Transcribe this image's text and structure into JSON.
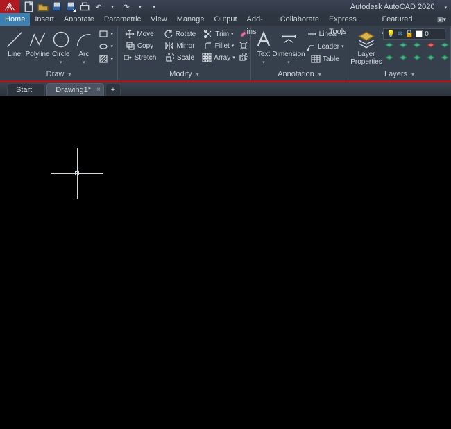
{
  "app": {
    "title": "Autodesk AutoCAD 2020"
  },
  "qat_hint": {
    "undo": "◄",
    "redo": "►"
  },
  "menutabs": [
    "Home",
    "Insert",
    "Annotate",
    "Parametric",
    "View",
    "Manage",
    "Output",
    "Add-ins",
    "Collaborate",
    "Express Tools",
    "Featured Apps"
  ],
  "menutabs_active": 0,
  "ribbon": {
    "draw": {
      "title": "Draw",
      "tools": {
        "line": "Line",
        "polyline": "Polyline",
        "circle": "Circle",
        "arc": "Arc"
      }
    },
    "modify": {
      "title": "Modify",
      "row1": {
        "move": "Move",
        "rotate": "Rotate",
        "trim": "Trim"
      },
      "row2": {
        "copy": "Copy",
        "mirror": "Mirror",
        "fillet": "Fillet"
      },
      "row3": {
        "stretch": "Stretch",
        "scale": "Scale",
        "array": "Array"
      }
    },
    "annotation": {
      "title": "Annotation",
      "text": "Text",
      "dimension": "Dimension",
      "linear": "Linear",
      "leader": "Leader",
      "table": "Table"
    },
    "layers": {
      "title": "Layers",
      "props": "Layer\nProperties",
      "current": "0"
    }
  },
  "doctabs": {
    "start": "Start",
    "drawing": "Drawing1*"
  }
}
